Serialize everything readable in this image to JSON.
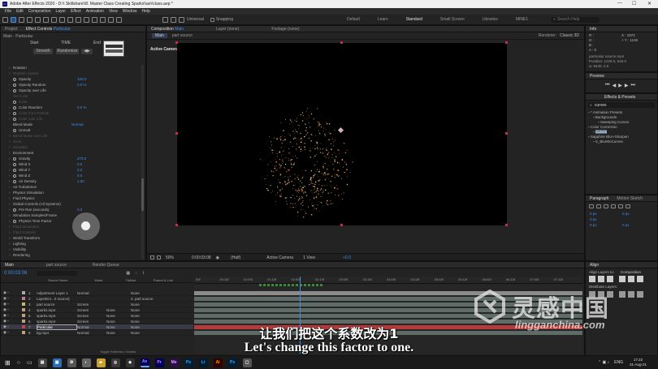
{
  "window": {
    "title": "Adobe After Effects 2020 - D:\\\\ Skillshare\\\\8. Master Class Creating Sparks\\\\ae\\\\class.aep *"
  },
  "menu": [
    "File",
    "Edit",
    "Composition",
    "Layer",
    "Effect",
    "Animation",
    "View",
    "Window",
    "Help"
  ],
  "toolbar": {
    "universal": "Universal",
    "snapping": "Snapping"
  },
  "workspaces": [
    "Default",
    "Learn",
    "Standard",
    "Small Screen",
    "Libraries",
    "MINE1"
  ],
  "workspace_active": "Standard",
  "search_help": "Search Help",
  "project_panel": {
    "tab_project": "Project",
    "tab_effect_controls": "Effect Controls",
    "effect_controls_layer": "Particular",
    "breadcrumb": "Main · Particular",
    "time_curve": {
      "start": "Start",
      "time": "TIME",
      "end": "End",
      "smooth": "Smooth",
      "randomize": "Randomize"
    },
    "properties": [
      {
        "name": "Rotation",
        "value": "",
        "dim": false,
        "tri": true,
        "sw": false
      },
      {
        "name": "Rotation Speed",
        "value": "",
        "dim": true,
        "tri": true,
        "sw": false
      },
      {
        "name": "Opacity",
        "value": "100.0",
        "dim": false,
        "tri": false,
        "sw": true
      },
      {
        "name": "Opacity Random",
        "value": "0.0 %",
        "dim": false,
        "tri": true,
        "sw": true
      },
      {
        "name": "Opacity over Life",
        "value": "",
        "dim": false,
        "tri": true,
        "sw": true
      },
      {
        "name": "Set Color",
        "value": "",
        "dim": true,
        "tri": false,
        "sw": false
      },
      {
        "name": "Color",
        "value": "",
        "dim": true,
        "tri": false,
        "sw": true
      },
      {
        "name": "Color Random",
        "value": "0.0 %",
        "dim": false,
        "tri": true,
        "sw": true
      },
      {
        "name": "Color from Particle",
        "value": "",
        "dim": true,
        "tri": true,
        "sw": true
      },
      {
        "name": "Color over Life",
        "value": "",
        "dim": true,
        "tri": true,
        "sw": true
      },
      {
        "name": "Blend Mode",
        "value": "Normal",
        "dim": false,
        "tri": false,
        "sw": false
      },
      {
        "name": "Unmult",
        "value": "",
        "dim": false,
        "tri": false,
        "sw": true
      },
      {
        "name": "Blend Mode over Life",
        "value": "",
        "dim": true,
        "tri": true,
        "sw": false
      },
      {
        "name": "Glow",
        "value": "",
        "dim": true,
        "tri": true,
        "sw": false
      },
      {
        "name": "Streaklet",
        "value": "",
        "dim": true,
        "tri": true,
        "sw": false
      },
      {
        "name": "Environment",
        "value": "",
        "dim": false,
        "tri": true,
        "sw": false
      },
      {
        "name": "Gravity",
        "value": "270.0",
        "dim": false,
        "tri": true,
        "sw": true
      },
      {
        "name": "Wind X",
        "value": "0.0",
        "dim": false,
        "tri": true,
        "sw": true
      },
      {
        "name": "Wind Y",
        "value": "0.0",
        "dim": false,
        "tri": true,
        "sw": true
      },
      {
        "name": "Wind Z",
        "value": "0.0",
        "dim": false,
        "tri": true,
        "sw": true
      },
      {
        "name": "Air Density",
        "value": "1.00",
        "dim": false,
        "tri": true,
        "sw": true
      },
      {
        "name": "Air Turbulence",
        "value": "",
        "dim": false,
        "tri": true,
        "sw": false
      },
      {
        "name": "Physics Simulation",
        "value": "",
        "dim": false,
        "tri": true,
        "sw": false
      },
      {
        "name": "Fluid Physics",
        "value": "",
        "dim": false,
        "tri": true,
        "sw": false
      },
      {
        "name": "Global Controls (All Systems)",
        "value": "",
        "dim": false,
        "tri": true,
        "sw": false
      },
      {
        "name": "Pre Run (seconds)",
        "value": "0.0",
        "dim": false,
        "tri": true,
        "sw": true
      },
      {
        "name": "Simulation Samples/Frame",
        "value": "",
        "dim": false,
        "tri": true,
        "sw": false
      },
      {
        "name": "Physics Time Factor",
        "value": "",
        "dim": false,
        "tri": true,
        "sw": true
      },
      {
        "name": "Fluid Simulation",
        "value": "",
        "dim": true,
        "tri": true,
        "sw": false
      },
      {
        "name": "Fluid Controls",
        "value": "",
        "dim": true,
        "tri": true,
        "sw": false
      },
      {
        "name": "World Transform",
        "value": "",
        "dim": false,
        "tri": true,
        "sw": false
      },
      {
        "name": "Lighting",
        "value": "",
        "dim": false,
        "tri": true,
        "sw": false
      },
      {
        "name": "Visibility",
        "value": "",
        "dim": false,
        "tri": true,
        "sw": false
      },
      {
        "name": "Rendering",
        "value": "",
        "dim": false,
        "tri": true,
        "sw": false
      }
    ]
  },
  "viewer": {
    "tab_composition": "Composition",
    "comp_name": "Main",
    "tab_layer": "Layer (none)",
    "tab_footage": "Footage (none)",
    "subtabs": [
      "Main",
      "part source"
    ],
    "renderer_label": "Renderer:",
    "renderer": "Classic 3D",
    "camera_label": "Active Camera",
    "bottom": {
      "zoom": "50%",
      "timecode": "0:00:03:08",
      "quality": "(Half)",
      "camera": "Active Camera",
      "views": "1 View",
      "offset": "+0.0"
    }
  },
  "info_panel": {
    "title": "Info",
    "r": "R :",
    "g": "G :",
    "b": "B :",
    "a": "A : 0",
    "x": "X : 1972",
    "y": "+ Y : 1146",
    "line1": "particular source.mp4",
    "line2": "Position: 1229.0, 540.0",
    "line3": "Δ: 9440, 0.0"
  },
  "preview_panel": {
    "title": "Preview"
  },
  "effects_presets": {
    "title": "Effects & Presets",
    "search_value": "curves",
    "items": [
      {
        "label": "* Animation Presets",
        "indent": 0
      },
      {
        "label": "Backgrounds",
        "indent": 1
      },
      {
        "label": "Sweeping Curves",
        "indent": 2
      },
      {
        "label": "Color Correction",
        "indent": 0
      },
      {
        "label": "Curves",
        "indent": 1
      },
      {
        "label": "Sapphire Blur+Sharpen",
        "indent": 0
      },
      {
        "label": "S_BlurMoCurves",
        "indent": 1
      }
    ]
  },
  "paragraph_panel": {
    "title": "Paragraph",
    "tab2": "Motion Sketch",
    "v1": "0 px",
    "v2": "0 px",
    "v3": "0 px",
    "v4": "0 px",
    "v5": "0 px"
  },
  "align_panel": {
    "title": "Align",
    "align_to_label": "Align Layers to:",
    "align_to": "Composition",
    "distribute": "Distribute Layers:"
  },
  "timeline": {
    "tabs": [
      "Main",
      "part source",
      "Render Queue"
    ],
    "timecode": "0:00:03:08",
    "columns": {
      "source": "Source Name",
      "mode": "Mode",
      "trkmat": "TrkMat",
      "parent": "Parent & Link"
    },
    "ruler": [
      "00f",
      "00:15f",
      "01:00f",
      "01:15f",
      "02:00f",
      "02:15f",
      "03:00f",
      "03:15f",
      "04:00f",
      "04:15f",
      "05:00f",
      "05:15f",
      "06:00f",
      "06:15f",
      "07:00f",
      "07:15f"
    ],
    "layers": [
      {
        "num": "1",
        "name": "Adjustment Layer 1",
        "mode": "Normal",
        "trk": "",
        "parent": "None",
        "color": "#a8a8a8",
        "selected": false
      },
      {
        "num": "2",
        "name": "LayerEm...rt source]",
        "mode": "",
        "trk": "",
        "parent": "3. part source",
        "color": "#c47a8a",
        "selected": false
      },
      {
        "num": "3",
        "name": "part source",
        "mode": "Screen",
        "trk": "",
        "parent": "None",
        "color": "#bfbf66",
        "selected": false
      },
      {
        "num": "4",
        "name": "sparks.mp4",
        "mode": "Screen",
        "trk": "None",
        "parent": "None",
        "color": "#bfa07a",
        "selected": false
      },
      {
        "num": "5",
        "name": "sparks.mp4",
        "mode": "Screen",
        "trk": "None",
        "parent": "None",
        "color": "#bfa07a",
        "selected": false
      },
      {
        "num": "6",
        "name": "sparks.mp4",
        "mode": "Screen",
        "trk": "None",
        "parent": "None",
        "color": "#bfa07a",
        "selected": false
      },
      {
        "num": "7",
        "name": "Particular",
        "mode": "Normal",
        "trk": "None",
        "parent": "None",
        "color": "#c84040",
        "selected": true
      },
      {
        "num": "8",
        "name": "bg.mp4",
        "mode": "Normal",
        "trk": "None",
        "parent": "None",
        "color": "#bfa07a",
        "selected": false
      }
    ],
    "toggle_label": "Toggle Switches / Modes"
  },
  "subtitles": {
    "zh": "让我们把这个系数改为1",
    "en": "Let's change this factor to one."
  },
  "watermark": {
    "brand": "灵感中国",
    "url": "lingganchina.com"
  },
  "taskbar": {
    "apps": [
      "Ae",
      "Pr",
      "Ps",
      "Lr",
      "Ai",
      "Ps"
    ],
    "lang": "ENG",
    "time": "17:22",
    "date": "31-Aug-21"
  },
  "colors": {
    "accent": "#3d8fe8",
    "layer_selected": "#c84040",
    "taskbar": "#1a1a1a"
  }
}
